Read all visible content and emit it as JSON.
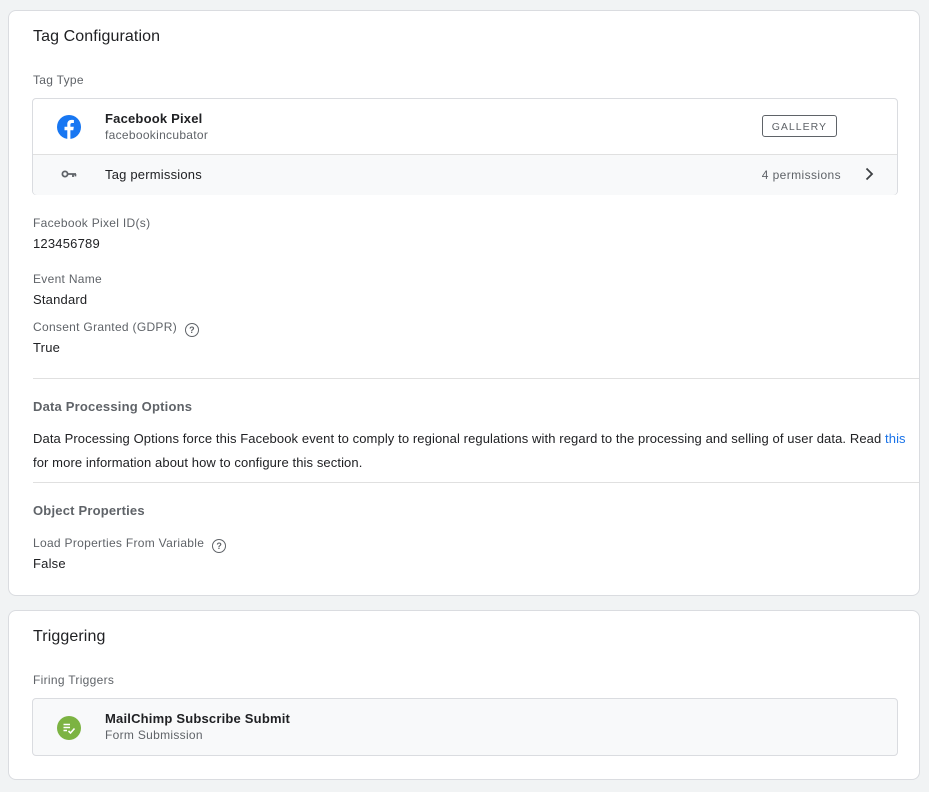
{
  "tag_configuration": {
    "title": "Tag Configuration",
    "tag_type_label": "Tag Type",
    "tag_type": {
      "name": "Facebook Pixel",
      "publisher": "facebookincubator",
      "icon": "facebook-icon",
      "gallery_button": "GALLERY"
    },
    "permissions": {
      "icon": "key-icon",
      "label": "Tag permissions",
      "count": "4 permissions"
    },
    "fields": {
      "pixel_id": {
        "label": "Facebook Pixel ID(s)",
        "value": "123456789"
      },
      "event_name": {
        "label": "Event Name",
        "value": "Standard"
      },
      "consent": {
        "label": "Consent Granted (GDPR)",
        "value": "True"
      }
    },
    "data_processing": {
      "heading": "Data Processing Options",
      "text_before_link": "Data Processing Options force this Facebook event to comply to regional regulations with regard to the processing and selling of user data. Read ",
      "link_text": "this",
      "text_after_link": " for more information about how to configure this section."
    },
    "object_properties": {
      "heading": "Object Properties",
      "load_from_variable": {
        "label": "Load Properties From Variable",
        "value": "False"
      }
    }
  },
  "triggering": {
    "title": "Triggering",
    "firing_triggers_label": "Firing Triggers",
    "trigger": {
      "name": "MailChimp Subscribe Submit",
      "type": "Form Submission",
      "icon": "form-submission-icon"
    }
  },
  "colors": {
    "facebook_blue": "#1877f2",
    "trigger_green": "#7cb342",
    "link_blue": "#1a73e8"
  }
}
